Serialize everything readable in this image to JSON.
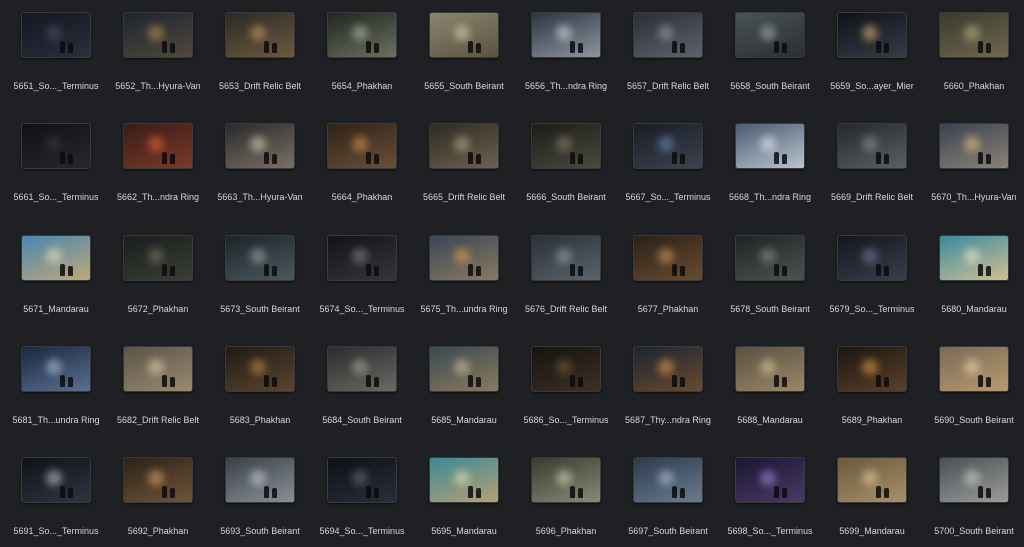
{
  "files": [
    {
      "name": "5651_So..._Terminus",
      "bg": [
        "#141620",
        "#2a2f3c"
      ],
      "glow": "#4a5468"
    },
    {
      "name": "5652_Th...Hyura-Van",
      "bg": [
        "#1d2530",
        "#50483a"
      ],
      "glow": "#c89a58"
    },
    {
      "name": "5653_Drift Relic Belt",
      "bg": [
        "#2a2a24",
        "#6b5a40"
      ],
      "glow": "#d0a060"
    },
    {
      "name": "5654_Phakhan",
      "bg": [
        "#22261f",
        "#6a7060"
      ],
      "glow": "#b8c0a8"
    },
    {
      "name": "5655_South Beirant",
      "bg": [
        "#8a8670",
        "#5a5340"
      ],
      "glow": "#e0d6b0"
    },
    {
      "name": "5656_Th...ndra Ring",
      "bg": [
        "#2c3440",
        "#8d96a0"
      ],
      "glow": "#d8dee6"
    },
    {
      "name": "5657_Drift Relic Belt",
      "bg": [
        "#2a2e36",
        "#5d636c"
      ],
      "glow": "#9aa2ac"
    },
    {
      "name": "5658_South Beirant",
      "bg": [
        "#4a5258",
        "#2a2f30"
      ],
      "glow": "#a8b4b8"
    },
    {
      "name": "5659_So...ayer_Mier",
      "bg": [
        "#0e1118",
        "#363c48"
      ],
      "glow": "#f0c070"
    },
    {
      "name": "5660_Phakhan",
      "bg": [
        "#3a3a2c",
        "#706850"
      ],
      "glow": "#c8b888"
    },
    {
      "name": "5661_So..._Terminus",
      "bg": [
        "#101114",
        "#25272b"
      ],
      "glow": "#3a3c42"
    },
    {
      "name": "5662_Th...ndra Ring",
      "bg": [
        "#3a1c18",
        "#7a3a28"
      ],
      "glow": "#f06a3a"
    },
    {
      "name": "5663_Th...Hyura-Van",
      "bg": [
        "#2a2a2a",
        "#7a7066"
      ],
      "glow": "#e6d8c0"
    },
    {
      "name": "5664_Phakhan",
      "bg": [
        "#2e2218",
        "#6a5038"
      ],
      "glow": "#e09a48"
    },
    {
      "name": "5665_Drift Relic Belt",
      "bg": [
        "#2e2a22",
        "#6c6250"
      ],
      "glow": "#c0b090"
    },
    {
      "name": "5666_South Beirant",
      "bg": [
        "#1c1c18",
        "#4c4a3e"
      ],
      "glow": "#8c8670"
    },
    {
      "name": "5667_So..._Terminus",
      "bg": [
        "#181c24",
        "#3c4450"
      ],
      "glow": "#7090c0"
    },
    {
      "name": "5668_Th...ndra Ring",
      "bg": [
        "#4c5c70",
        "#b8c4d0"
      ],
      "glow": "#eef2f6"
    },
    {
      "name": "5669_Drift Relic Belt",
      "bg": [
        "#24282a",
        "#5a6064"
      ],
      "glow": "#8e969a"
    },
    {
      "name": "5670_Th...Hyura-Van",
      "bg": [
        "#3a4250",
        "#8a8478"
      ],
      "glow": "#f0c888"
    },
    {
      "name": "5671_Mandarau",
      "bg": [
        "#4a86b0",
        "#c0a878"
      ],
      "glow": "#f0e2b8"
    },
    {
      "name": "5672_Phakhan",
      "bg": [
        "#1a1e1c",
        "#3a3e36"
      ],
      "glow": "#7a7a60"
    },
    {
      "name": "5673_South Beirant",
      "bg": [
        "#1c2428",
        "#4a5a60"
      ],
      "glow": "#a0b0b0"
    },
    {
      "name": "5674_So..._Terminus",
      "bg": [
        "#121316",
        "#34363c"
      ],
      "glow": "#8a8c94"
    },
    {
      "name": "5675_Th...undra Ring",
      "bg": [
        "#3a4656",
        "#8a7a60"
      ],
      "glow": "#f0a048"
    },
    {
      "name": "5676_Drift Relic Belt",
      "bg": [
        "#2a3038",
        "#5a646c"
      ],
      "glow": "#9aa8b4"
    },
    {
      "name": "5677_Phakhan",
      "bg": [
        "#2a2018",
        "#6a4c30"
      ],
      "glow": "#e0a060"
    },
    {
      "name": "5678_South Beirant",
      "bg": [
        "#1e2422",
        "#4c5450"
      ],
      "glow": "#8a948c"
    },
    {
      "name": "5679_So..._Terminus",
      "bg": [
        "#14161e",
        "#3a3e4c"
      ],
      "glow": "#7a80a0"
    },
    {
      "name": "5680_Mandarau",
      "bg": [
        "#3a8aa0",
        "#d0c090"
      ],
      "glow": "#f6ecc8"
    },
    {
      "name": "5681_Th...undra Ring",
      "bg": [
        "#1a2840",
        "#5a7090"
      ],
      "glow": "#b8cce0"
    },
    {
      "name": "5682_Drift Relic Belt",
      "bg": [
        "#5a5448",
        "#9a8a70"
      ],
      "glow": "#e8d8b0"
    },
    {
      "name": "5683_Phakhan",
      "bg": [
        "#201a14",
        "#5a4630"
      ],
      "glow": "#d09050"
    },
    {
      "name": "5684_South Beirant",
      "bg": [
        "#2a2c2c",
        "#6a6a64"
      ],
      "glow": "#b0aca0"
    },
    {
      "name": "5685_Mandarau",
      "bg": [
        "#3a4a50",
        "#8a7a60"
      ],
      "glow": "#d8c8a0"
    },
    {
      "name": "5686_So..._Terminus",
      "bg": [
        "#16130f",
        "#3c3024"
      ],
      "glow": "#7a6040"
    },
    {
      "name": "5687_Thy...ndra Ring",
      "bg": [
        "#1c2430",
        "#6a4a30"
      ],
      "glow": "#f0a050"
    },
    {
      "name": "5688_Mandarau",
      "bg": [
        "#5a5040",
        "#9a8868"
      ],
      "glow": "#e0cfa0"
    },
    {
      "name": "5689_Phakhan",
      "bg": [
        "#1c1610",
        "#5a4028"
      ],
      "glow": "#f0a850"
    },
    {
      "name": "5690_South Beirant",
      "bg": [
        "#7a6a54",
        "#b89a70"
      ],
      "glow": "#f0dcb0"
    },
    {
      "name": "5691_So..._Terminus",
      "bg": [
        "#101218",
        "#2e3440"
      ],
      "glow": "#c8d4e8"
    },
    {
      "name": "5692_Phakhan",
      "bg": [
        "#2c2218",
        "#705438"
      ],
      "glow": "#e8b070"
    },
    {
      "name": "5693_South Beirant",
      "bg": [
        "#3a4048",
        "#8a9098"
      ],
      "glow": "#d0d6dc"
    },
    {
      "name": "5694_So..._Terminus",
      "bg": [
        "#0e1016",
        "#2a2e3a"
      ],
      "glow": "#6a7488"
    },
    {
      "name": "5695_Mandarau",
      "bg": [
        "#3a8a98",
        "#b8a070"
      ],
      "glow": "#f0e0b0"
    },
    {
      "name": "5696_Phakhan",
      "bg": [
        "#3a3a30",
        "#8a8a78"
      ],
      "glow": "#d8d8c0"
    },
    {
      "name": "5697_South Beirant",
      "bg": [
        "#2c3a4c",
        "#6a7c90"
      ],
      "glow": "#b8c8d8"
    },
    {
      "name": "5698_So..._Terminus",
      "bg": [
        "#1a1630",
        "#4a3a6a"
      ],
      "glow": "#b090e0"
    },
    {
      "name": "5699_Mandarau",
      "bg": [
        "#6a5a40",
        "#a89068"
      ],
      "glow": "#e8d0a0"
    },
    {
      "name": "5700_South Beirant",
      "bg": [
        "#4a5056",
        "#9a9c98"
      ],
      "glow": "#d8d8d0"
    }
  ]
}
